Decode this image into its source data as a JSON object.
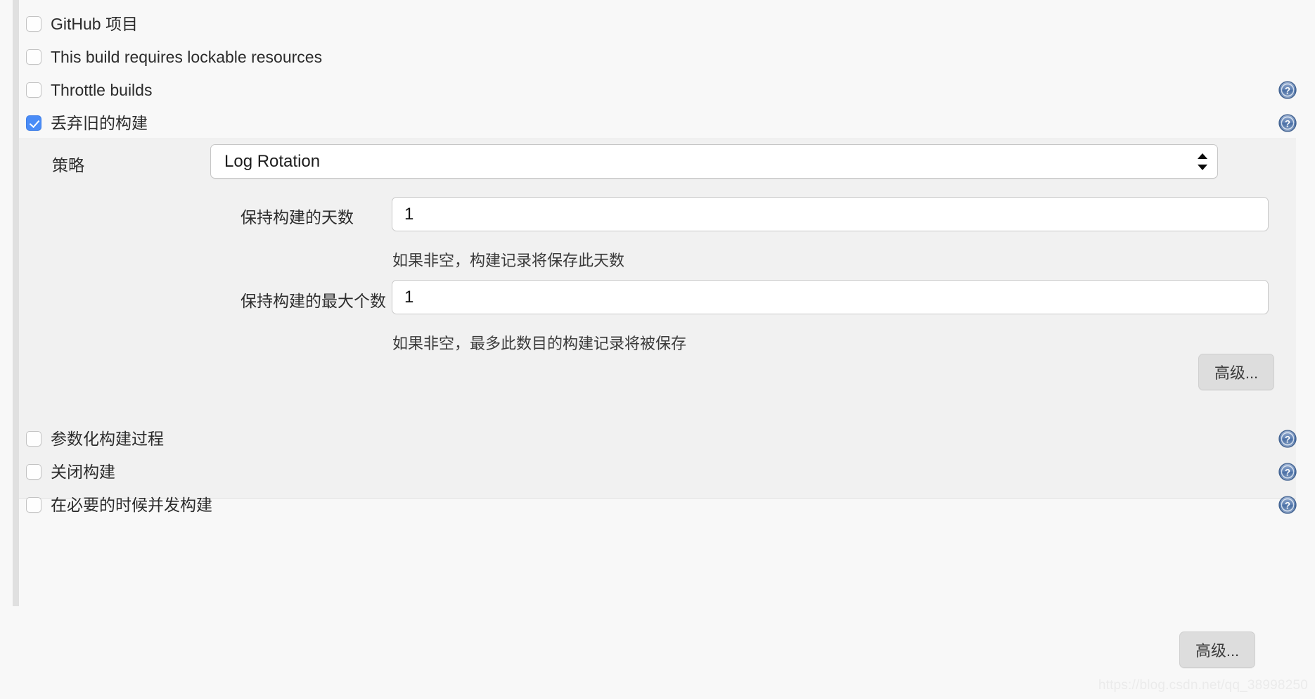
{
  "checkboxes_top": [
    {
      "label": "GitHub 项目",
      "checked": false,
      "help": false
    },
    {
      "label": "This build requires lockable resources",
      "checked": false,
      "help": false
    },
    {
      "label": "Throttle builds",
      "checked": false,
      "help": true
    },
    {
      "label": "丢弃旧的构建",
      "checked": true,
      "help": true
    }
  ],
  "discard_section": {
    "strategy_label": "策略",
    "strategy_value": "Log Rotation",
    "strategy_options": [
      "Log Rotation"
    ],
    "days_label": "保持构建的天数",
    "days_value": "1",
    "days_hint": "如果非空，构建记录将保存此天数",
    "max_label": "保持构建的最大个数",
    "max_value": "1",
    "max_hint": "如果非空，最多此数目的构建记录将被保存",
    "advanced_label": "高级..."
  },
  "checkboxes_bottom": [
    {
      "label": "参数化构建过程",
      "checked": false,
      "help": true
    },
    {
      "label": "关闭构建",
      "checked": false,
      "help": true
    },
    {
      "label": "在必要的时候并发构建",
      "checked": false,
      "help": true
    }
  ],
  "page_advanced_label": "高级...",
  "watermark": "https://blog.csdn.net/qq_38998250",
  "colors": {
    "accent": "#4a8cf7",
    "page_bg": "#f8f8f8",
    "panel_bg": "#f1f1f1",
    "help_icon": "#4a6fa5"
  },
  "icons": {
    "help": "help-question-icon",
    "checkbox": "checkbox-icon",
    "select_arrows": "select-updown-arrows-icon"
  }
}
